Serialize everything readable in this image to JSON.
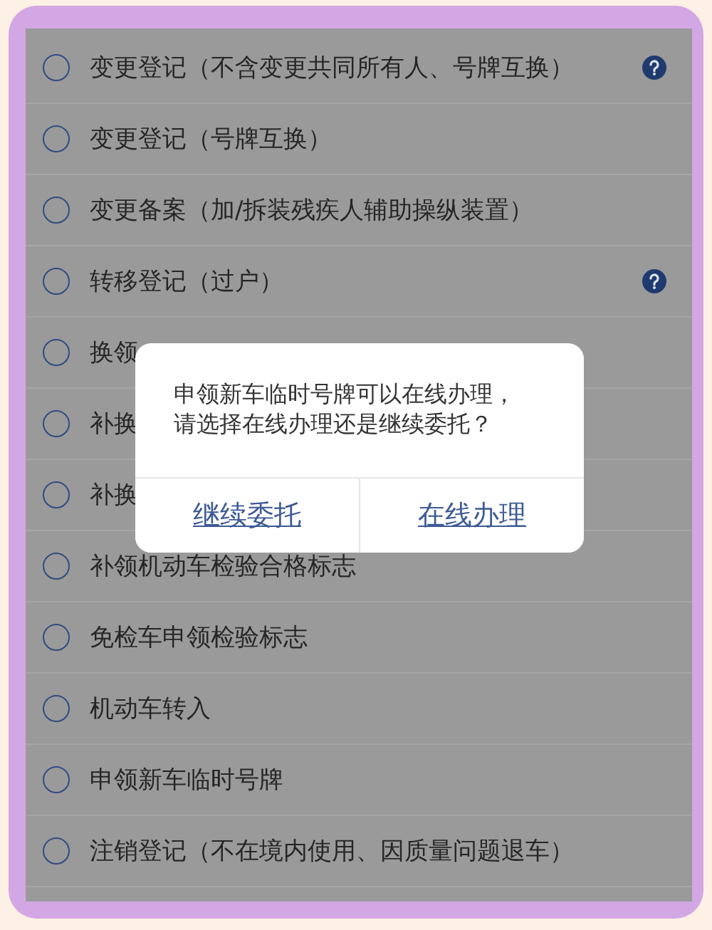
{
  "options": [
    {
      "label": "变更登记（不含变更共同所有人、号牌互换）",
      "selected": false,
      "help": true
    },
    {
      "label": "变更登记（号牌互换）",
      "selected": false,
      "help": false
    },
    {
      "label": "变更备案（加/拆装残疾人辅助操纵装置）",
      "selected": false,
      "help": false
    },
    {
      "label": "转移登记（过户）",
      "selected": false,
      "help": true
    },
    {
      "label": "换领",
      "selected": false,
      "help": false
    },
    {
      "label": "补换",
      "selected": false,
      "help": false
    },
    {
      "label": "补换",
      "selected": false,
      "help": false
    },
    {
      "label": "补领机动车检验合格标志",
      "selected": false,
      "help": false
    },
    {
      "label": "免检车申领检验标志",
      "selected": false,
      "help": false
    },
    {
      "label": "机动车转入",
      "selected": false,
      "help": false
    },
    {
      "label": "申领新车临时号牌",
      "selected": false,
      "help": false
    },
    {
      "label": "注销登记（不在境内使用、因质量问题退车）",
      "selected": false,
      "help": false
    }
  ],
  "dialog": {
    "message": [
      "申领新车临时号牌可以在线办理，",
      "请选择在线办理还是继续委托？"
    ],
    "buttons": [
      "继续委托",
      "在线办理"
    ]
  }
}
